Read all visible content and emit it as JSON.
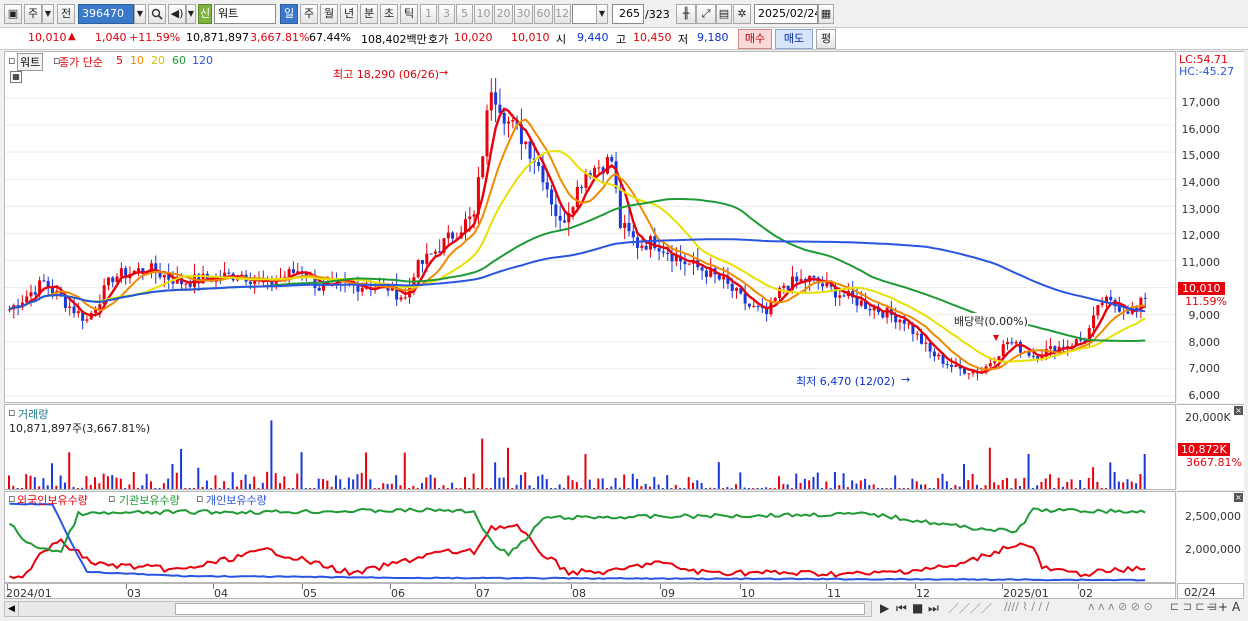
{
  "toolbar": {
    "type_label": "주",
    "prev_label": "전",
    "code_value": "396470",
    "name_badge": "신",
    "name_value": "워트",
    "periods": [
      "일",
      "주",
      "월",
      "년",
      "분",
      "초",
      "틱"
    ],
    "selected_period": "일",
    "intervals": [
      "1",
      "3",
      "5",
      "10",
      "20",
      "30",
      "60",
      "120"
    ],
    "count_value": "265",
    "count_total": "/323",
    "date_value": "2025/02/24"
  },
  "quote": {
    "price": "10,010",
    "arrow": "▲",
    "change": "1,040",
    "change_pct": "+11.59%",
    "volume": "10,871,897",
    "volume_ratio": "3,667.81%",
    "turnover": "67.44%",
    "amount": "108,402백만",
    "ask_label": "호가",
    "ask1": "10,020",
    "ask2": "10,010",
    "open_label": "시",
    "open": "9,440",
    "high_label": "고",
    "high": "10,450",
    "low_label": "저",
    "low": "9,180",
    "buy_label": "매수",
    "sell_label": "매도",
    "eval_label": "평"
  },
  "price_panel": {
    "stock_name": "워트",
    "series_label": "종가 단순",
    "ma_periods": [
      "5",
      "10",
      "20",
      "60",
      "120"
    ],
    "ma_colors": [
      "#e8000c",
      "#f08a00",
      "#e8e000",
      "#1f9a35",
      "#2a55e0"
    ],
    "high_annotation": "최고 18,290 (06/26)",
    "low_annotation": "최저 6,470 (12/02)",
    "dividend_annotation": "배당락(0.00%)",
    "lc": "LC:54.71",
    "hc": "HC:-45.27",
    "current_price_tag": "10,010",
    "current_pct_tag": "11.59%",
    "y_ticks": [
      "18,000",
      "17,000",
      "16,000",
      "15,000",
      "14,000",
      "13,000",
      "12,000",
      "11,000",
      "9,000",
      "8,000",
      "7,000",
      "6,000"
    ]
  },
  "volume_panel": {
    "title": "거래량",
    "value_label": "10,871,897주(3,667.81%)",
    "axis_top": "20,000K",
    "tag_value": "10,872K",
    "tag_pct": "3667.81%"
  },
  "holding_panel": {
    "legend": [
      "외국인보유수량",
      "기관보유수량",
      "개인보유수량"
    ],
    "y_ticks": [
      "2,500,000",
      "2,000,000"
    ]
  },
  "x_axis": {
    "labels": [
      "2024/01",
      "03",
      "04",
      "05",
      "06",
      "07",
      "08",
      "09",
      "10",
      "11",
      "12",
      "2025/01",
      "02"
    ],
    "right_label": "02/24"
  },
  "chart_data": {
    "type": "line",
    "title": "",
    "x": [
      "2024-01",
      "2024-02",
      "2024-03",
      "2024-04",
      "2024-05",
      "2024-06",
      "2024-06-26",
      "2024-07",
      "2024-08",
      "2024-09",
      "2024-10",
      "2024-11",
      "2024-12-02",
      "2025-01",
      "2025-02-24"
    ],
    "series": [
      {
        "name": "종가 단순 5",
        "values": [
          9200,
          10100,
          10200,
          10600,
          10200,
          10100,
          17500,
          15200,
          14200,
          10200,
          9700,
          8900,
          6800,
          8900,
          9300
        ]
      },
      {
        "name": "120",
        "values": [
          9800,
          9900,
          10000,
          10300,
          10200,
          10200,
          10700,
          11200,
          11700,
          11600,
          11300,
          10900,
          10300,
          9400,
          8900
        ]
      }
    ],
    "ylim": [
      6000,
      18500
    ],
    "volume_last": 10871897,
    "high": {
      "value": 18290,
      "date": "06/26"
    },
    "low": {
      "value": 6470,
      "date": "12/02"
    }
  }
}
